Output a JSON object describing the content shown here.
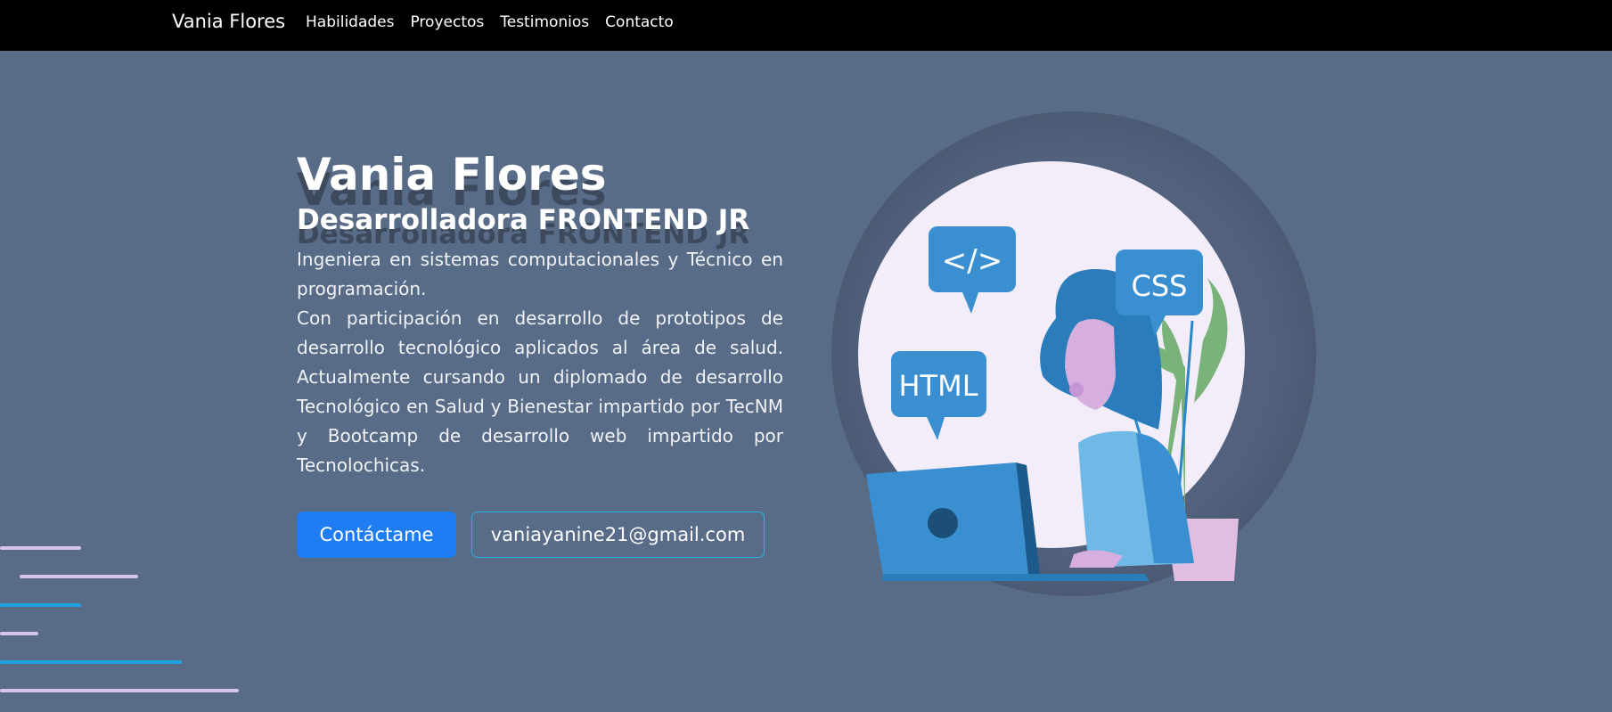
{
  "navbar": {
    "brand": "Vania Flores",
    "links": [
      "Habilidades",
      "Proyectos",
      "Testimonios",
      "Contacto"
    ]
  },
  "hero": {
    "name": "Vania Flores",
    "role": "Desarrolladora FRONTEND JR",
    "description_1": "Ingeniera en sistemas computacionales y Técnico en programación.",
    "description_2": "Con participación en desarrollo de prototipos de desarrollo tecnológico aplicados al área de salud. Actualmente cursando un diplomado de desarrollo Tecnológico en Salud y Bienestar impartido por TecNM y Bootcamp de desarrollo web impartido por Tecnolochicas.",
    "contact_button": "Contáctame",
    "email_button": "vaniayanine21@gmail.com",
    "illustration": {
      "bubble_code": "</>",
      "bubble_css": "CSS",
      "bubble_html": "HTML"
    }
  },
  "colors": {
    "navbar_bg": "#000000",
    "hero_bg": "#586b87",
    "primary": "#1f7cf3",
    "outline": "#2bb4e6",
    "line_lilac": "#d7c5ea",
    "line_blue": "#1fa3e0"
  }
}
